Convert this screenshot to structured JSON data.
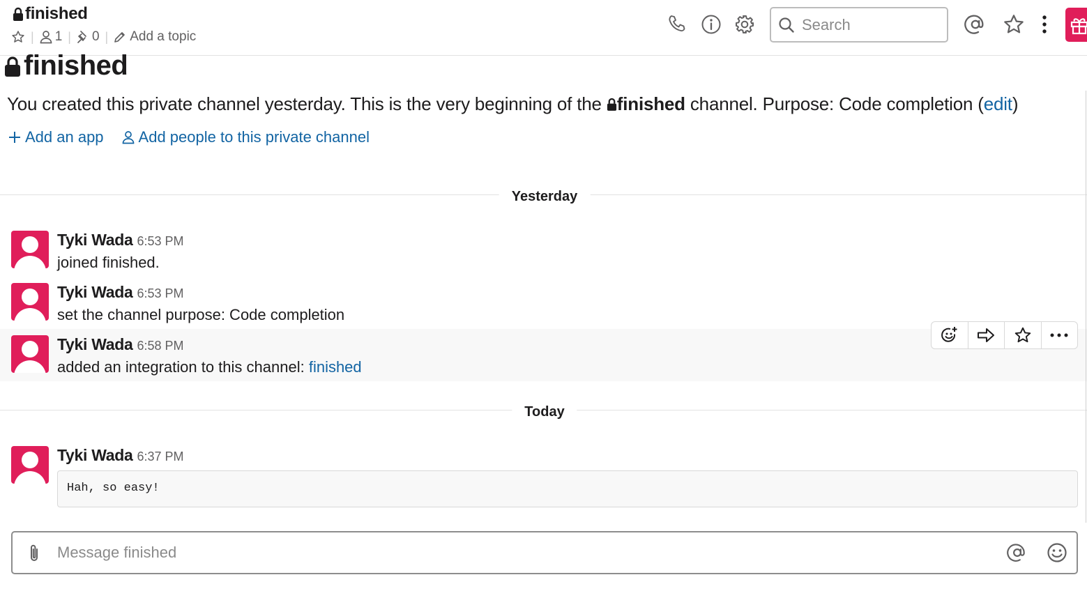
{
  "header": {
    "channel_name": "finished",
    "member_count": "1",
    "pinned_count": "0",
    "add_topic_label": "Add a topic",
    "search_placeholder": "Search"
  },
  "intro": {
    "title": "finished",
    "text_before": "You created this private channel yesterday. This is the very beginning of the ",
    "channel_name": "finished",
    "text_after": " channel. Purpose: Code completion (",
    "edit_link": "edit",
    "close_paren": ")",
    "add_app_label": "Add an app",
    "add_people_label": "Add people to this private channel"
  },
  "days": [
    {
      "label": "Yesterday"
    },
    {
      "label": "Today"
    }
  ],
  "messages": [
    {
      "author": "Tyki Wada",
      "time": "6:53 PM",
      "text": "joined finished."
    },
    {
      "author": "Tyki Wada",
      "time": "6:53 PM",
      "text": "set the channel purpose: Code completion"
    },
    {
      "author": "Tyki Wada",
      "time": "6:58 PM",
      "text": "added an integration to this channel: ",
      "link": "finished"
    },
    {
      "author": "Tyki Wada",
      "time": "6:37 PM",
      "code": "Hah, so easy!"
    }
  ],
  "composer": {
    "placeholder": "Message finished"
  },
  "colors": {
    "accent": "#e01e5a",
    "link": "#1264a3",
    "text": "#1d1c1d",
    "muted": "#616061"
  }
}
